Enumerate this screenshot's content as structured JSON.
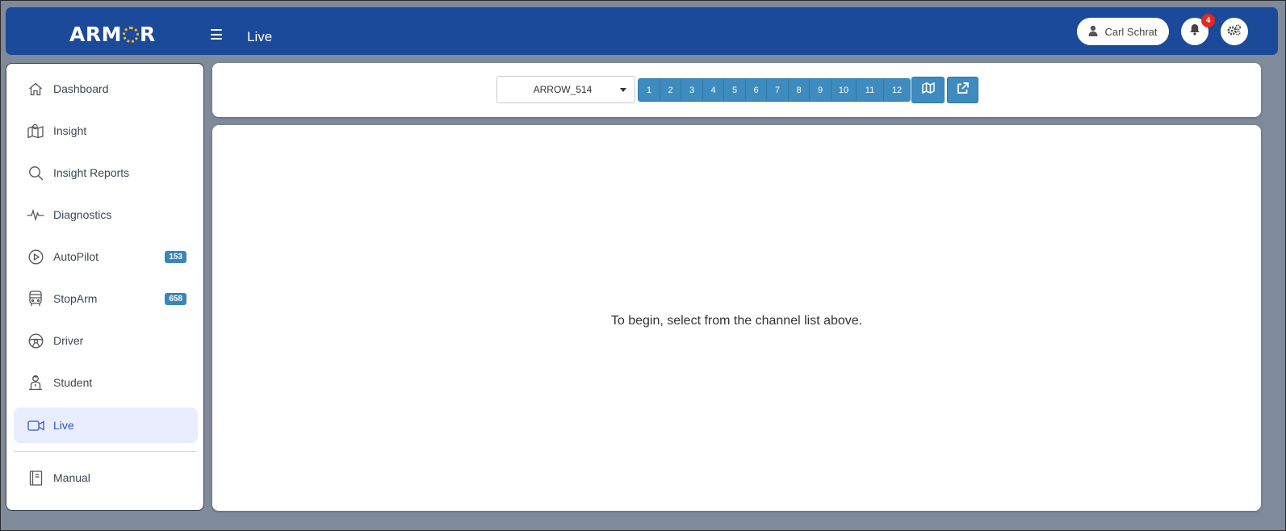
{
  "header": {
    "logo_text_left": "ARM",
    "logo_text_right": "R",
    "page_title": "Live",
    "user_name": "Carl Schrat",
    "notification_count": "4"
  },
  "sidebar": {
    "items": [
      {
        "label": "Dashboard",
        "icon": "home-icon"
      },
      {
        "label": "Insight",
        "icon": "map-icon"
      },
      {
        "label": "Insight Reports",
        "icon": "search-icon"
      },
      {
        "label": "Diagnostics",
        "icon": "pulse-icon"
      },
      {
        "label": "AutoPilot",
        "icon": "play-circle-icon",
        "badge": "153"
      },
      {
        "label": "StopArm",
        "icon": "bus-icon",
        "badge": "658"
      },
      {
        "label": "Driver",
        "icon": "steering-wheel-icon"
      },
      {
        "label": "Student",
        "icon": "student-icon"
      },
      {
        "label": "Live",
        "icon": "video-camera-icon",
        "active": true
      }
    ],
    "manual_label": "Manual"
  },
  "channel_bar": {
    "device_selected": "ARROW_514",
    "channels": [
      "1",
      "2",
      "3",
      "4",
      "5",
      "6",
      "7",
      "8",
      "9",
      "10",
      "11",
      "12"
    ]
  },
  "main": {
    "empty_message": "To begin, select from the channel list above."
  },
  "colors": {
    "header_bg": "#1b4a9a",
    "accent_button": "#3e8bbf",
    "active_nav_bg": "#e9edfd",
    "active_nav_text": "#2f57c8",
    "notification_badge": "#e8261b",
    "logo_accent": "#f2b42a"
  }
}
